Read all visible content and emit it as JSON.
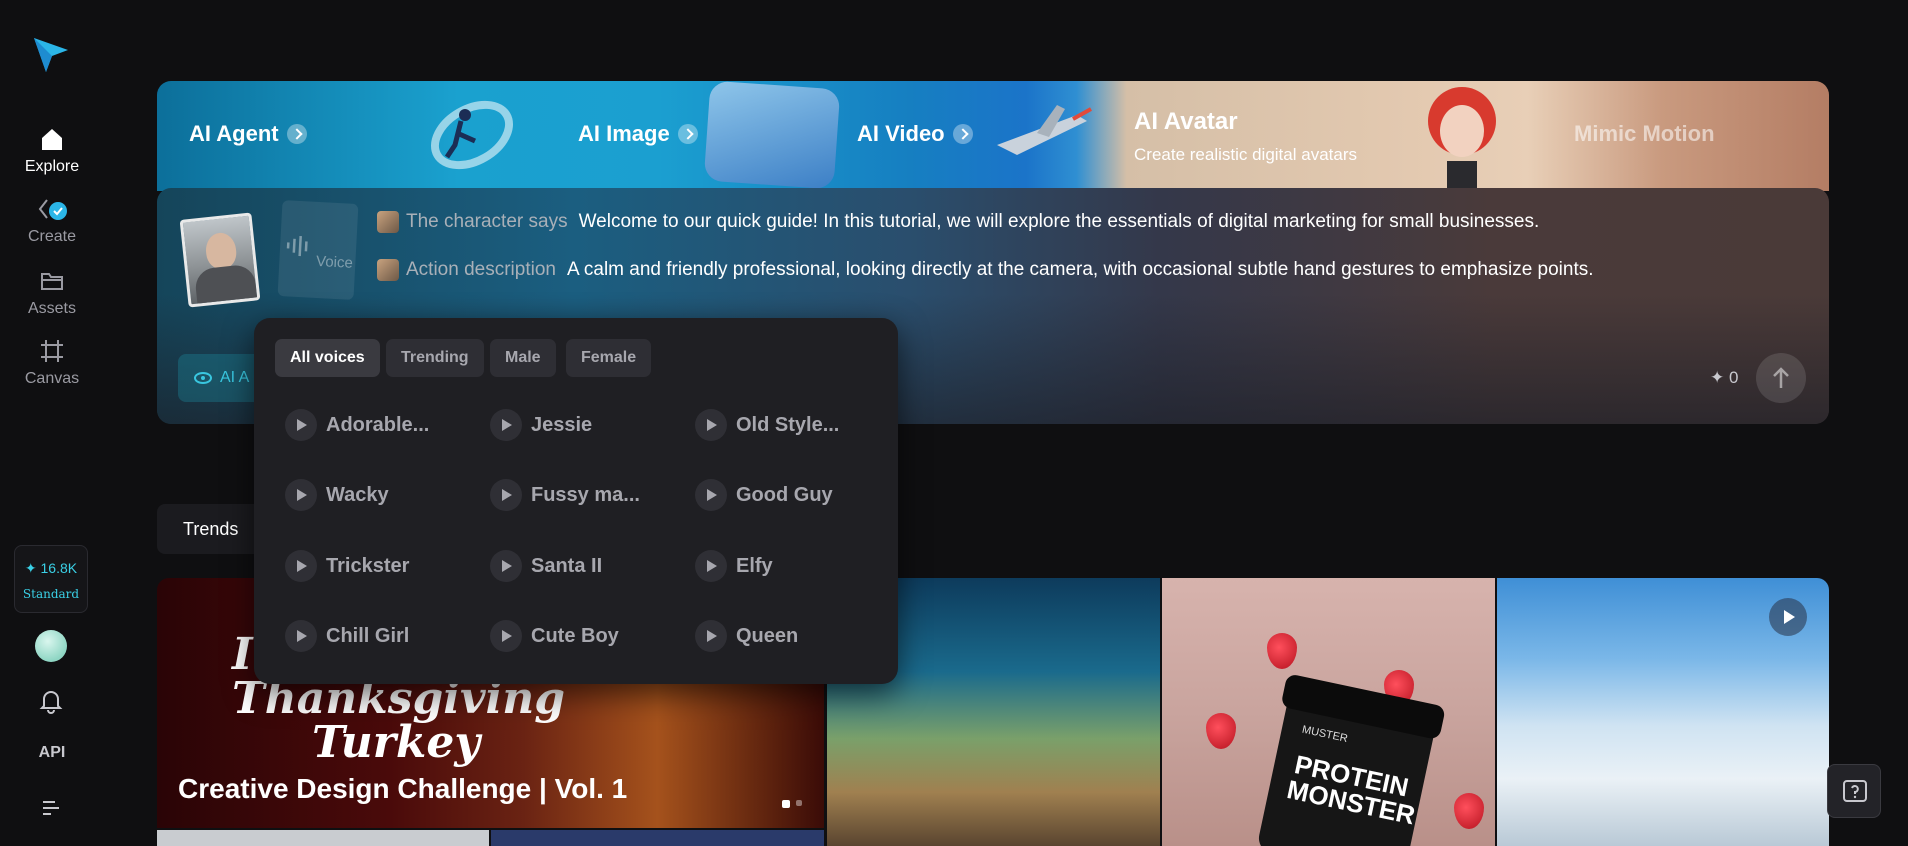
{
  "sidebar": {
    "nav": [
      {
        "label": "Explore",
        "icon": "home-icon"
      },
      {
        "label": "Create",
        "icon": "create-icon"
      },
      {
        "label": "Assets",
        "icon": "folder-icon"
      },
      {
        "label": "Canvas",
        "icon": "canvas-icon"
      }
    ],
    "credits": {
      "amount": "16.8K",
      "tier": "Standard"
    },
    "api_label": "API"
  },
  "banner": {
    "items": [
      {
        "label": "AI Agent"
      },
      {
        "label": "AI Image"
      },
      {
        "label": "AI Video"
      }
    ],
    "avatar_title": "AI Avatar",
    "avatar_subtitle": "Create realistic digital avatars",
    "mimic_label": "Mimic Motion"
  },
  "composer": {
    "voice_label": "Voice",
    "character_label": "The character says",
    "character_text": "Welcome to our quick guide! In this tutorial, we will explore the essentials of digital marketing for small businesses.",
    "action_label": "Action description",
    "action_text": "A calm and friendly professional, looking directly at the camera, with occasional subtle hand gestures to emphasize points.",
    "ai_chip": "AI A",
    "count": "0"
  },
  "voice_dropdown": {
    "tabs": [
      "All voices",
      "Trending",
      "Male",
      "Female"
    ],
    "voices": [
      "Adorable...",
      "Jessie",
      "Old Style...",
      "Wacky",
      "Fussy ma...",
      "Good Guy",
      "Trickster",
      "Santa II",
      "Elfy",
      "Chill Girl",
      "Cute Boy",
      "Queen"
    ]
  },
  "trends": {
    "active_tab": "Trends"
  },
  "gallery": {
    "featured_title_1": "In",
    "featured_title_2": "Thanksgiving",
    "featured_title_3": "Turkey",
    "featured_caption": "Creative Design Challenge | Vol. 1",
    "product_brand": "MUSTER",
    "product_name_1": "PROTEIN",
    "product_name_2": "MONSTER"
  }
}
